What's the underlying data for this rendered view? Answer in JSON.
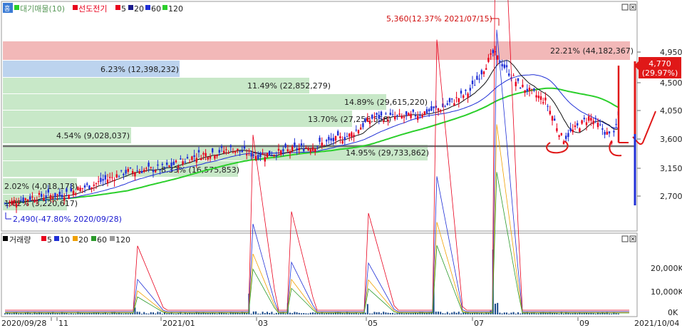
{
  "price_panel": {
    "legend": {
      "name": "대기매물(10)",
      "stock": "선도전기",
      "ma_labels": [
        "5",
        "20",
        "60",
        "120"
      ],
      "ma_colors": [
        "#e8001c",
        "#1a1a8c",
        "#1f2fd6",
        "#2bcf2b"
      ]
    },
    "home_button": "홈",
    "yaxis_ticks": [
      "4,950",
      "4,500",
      "4,050",
      "3,600",
      "3,150",
      "2,700"
    ],
    "current_price": "4,770",
    "current_change": "(29.97%)",
    "high_annotation": "5,360(12.37% 2021/07/15)",
    "low_annotation": "2,490(-47.80% 2020/09/28)",
    "volume_profile": [
      {
        "label": "22.21% (44,182,367)",
        "color": "#f2b8b8"
      },
      {
        "label": "6.23% (12,398,232)",
        "color": "#bcd3ee"
      },
      {
        "label": "11.49% (22,852,279)",
        "color": "#c8e8c8"
      },
      {
        "label": "14.89% (29,615,220)",
        "color": "#c8e8c8"
      },
      {
        "label": "13.70% (27,256,558)",
        "color": "#c8e8c8"
      },
      {
        "label": "4.54% (9,028,037)",
        "color": "#c8e8c8"
      },
      {
        "label": "14.95% (29,733,862)",
        "color": "#c8e8c8"
      },
      {
        "label": "8.33% (16,575,853)",
        "color": "#c8e8c8"
      },
      {
        "label": "2.02% (4,018,178)",
        "color": "#c8e8c8"
      },
      {
        "label": "1.62% (3,220,617)",
        "color": "#c8e8c8"
      }
    ]
  },
  "volume_panel": {
    "legend": {
      "name": "거래량",
      "ma_labels": [
        "5",
        "10",
        "20",
        "60",
        "120"
      ],
      "ma_colors": [
        "#e8001c",
        "#1f2fd6",
        "#f0a000",
        "#2b9a2b",
        "#9a9a9a"
      ]
    },
    "yaxis_ticks": [
      "20,000K",
      "10,000K",
      "0K"
    ]
  },
  "xaxis": {
    "start_label": "2020/09/28",
    "end_label": "2021/10/04",
    "labels": [
      "11",
      "2021/01",
      "03",
      "05",
      "07",
      "09"
    ]
  },
  "chart_data": {
    "type": "candlestick",
    "title": "선도전기",
    "x_range": [
      "2020/09/28",
      "2021/10/04"
    ],
    "y_range": [
      2500,
      5400
    ],
    "price_ticks": [
      2700,
      3150,
      3600,
      4050,
      4500,
      4950
    ],
    "high": {
      "value": 5360,
      "pct": 12.37,
      "date": "2021/07/15"
    },
    "low": {
      "value": 2490,
      "pct": -47.8,
      "date": "2020/09/28"
    },
    "current": {
      "value": 4770,
      "pct": 29.97
    },
    "close_series": [
      {
        "x": "2020/09/28",
        "y": 2600
      },
      {
        "x": "2020/10/15",
        "y": 2700
      },
      {
        "x": "2020/11/01",
        "y": 2740
      },
      {
        "x": "2020/11/20",
        "y": 2900
      },
      {
        "x": "2020/12/10",
        "y": 3100
      },
      {
        "x": "2021/01/01",
        "y": 3150
      },
      {
        "x": "2021/01/20",
        "y": 3350
      },
      {
        "x": "2021/02/10",
        "y": 3450
      },
      {
        "x": "2021/02/25",
        "y": 3350
      },
      {
        "x": "2021/03/10",
        "y": 3400
      },
      {
        "x": "2021/03/31",
        "y": 3500
      },
      {
        "x": "2021/04/20",
        "y": 3650
      },
      {
        "x": "2021/05/05",
        "y": 3950
      },
      {
        "x": "2021/05/25",
        "y": 3950
      },
      {
        "x": "2021/06/15",
        "y": 4100
      },
      {
        "x": "2021/07/01",
        "y": 4350
      },
      {
        "x": "2021/07/15",
        "y": 4950
      },
      {
        "x": "2021/07/30",
        "y": 4450
      },
      {
        "x": "2021/08/15",
        "y": 4200
      },
      {
        "x": "2021/08/25",
        "y": 3600
      },
      {
        "x": "2021/09/10",
        "y": 3950
      },
      {
        "x": "2021/09/24",
        "y": 3600
      },
      {
        "x": "2021/10/04",
        "y": 4770
      }
    ],
    "volume_spikes": [
      {
        "x": "2020/12/15",
        "v": 3000
      },
      {
        "x": "2021/02/20",
        "v": 9000
      },
      {
        "x": "2021/03/15",
        "v": 5000
      },
      {
        "x": "2021/05/01",
        "v": 4500
      },
      {
        "x": "2021/06/10",
        "v": 13000
      },
      {
        "x": "2021/07/15",
        "v": 28000
      },
      {
        "x": "2021/10/04",
        "v": 10500
      }
    ]
  }
}
